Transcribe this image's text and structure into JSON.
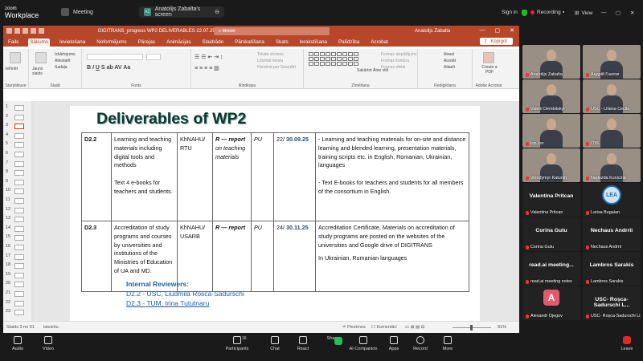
{
  "zoom": {
    "logo_top": "zoom",
    "logo_bottom": "Workplace",
    "tabs": [
      {
        "label": "Meeting"
      },
      {
        "label": "Anatolijs Zabalta's screen",
        "badge": "AZ"
      }
    ],
    "right": {
      "signin": "Sign in",
      "recording": "Recording",
      "view": "View"
    },
    "controls": [
      {
        "label": "Audio"
      },
      {
        "label": "Video"
      },
      {
        "label": "Participants",
        "count": "16"
      },
      {
        "label": "Chat"
      },
      {
        "label": "React"
      },
      {
        "label": "Share"
      },
      {
        "label": "AI Companion"
      },
      {
        "label": "Apps"
      },
      {
        "label": "Record"
      },
      {
        "label": "More"
      },
      {
        "label": "Leave"
      }
    ]
  },
  "ppt": {
    "title": "DIGITRANS_progress WP2 DELIVERABLES 22.07.25 Zabalta  -  PowerPoint",
    "search_placeholder": "Meklēt",
    "user": "Anatolijs Zabalta",
    "menu_tabs": [
      "Fails",
      "Sākums",
      "Ievietošana",
      "Noformējums",
      "Pārejas",
      "Animācijas",
      "Slaidrāde",
      "Pārskatīšana",
      "Skats",
      "Ierakstīšana",
      "Palīdzība",
      "Acrobat"
    ],
    "active_tab": "Sākums",
    "share_label": "Kopīgot",
    "ribbon": {
      "paste": "Ielīmēt",
      "new_slide": "Jauns slaids",
      "layout": "Izkārtojums",
      "reset": "Atiestatīt",
      "section": "Sadaļa",
      "groups": [
        "Starpliktuve",
        "Slaidi",
        "Fonts",
        "Rindkopa",
        "Zīmēšana",
        "Rediģēšana",
        "Adobe Acrobat"
      ],
      "text_direction": "Teksta virziens",
      "align_text": "Līdzināt tekstu",
      "smartart": "Pārvērst par SmartArt",
      "arrange": "Sakārtot",
      "quick_styles": "Ātrie stili",
      "shape_fill": "Formas aizpildījums",
      "shape_outline": "Formas kontūra",
      "shape_effects": "Formas efekti",
      "find": "Atrast",
      "replace": "Aizstāt",
      "select": "Atlasīt",
      "create_pdf": "Create a PDF"
    },
    "thumbnail_numbers": [
      "1",
      "2",
      "3",
      "4",
      "5",
      "6",
      "7",
      "8",
      "9",
      "10",
      "11",
      "12",
      "13",
      "14",
      "15",
      "16",
      "17",
      "18",
      "19",
      "20",
      "21",
      "22",
      "23"
    ],
    "slide": {
      "title": "Deliverables of WP2",
      "rows": [
        {
          "id": "D2.2",
          "name": "Learning and teaching materials including digital tools and methods",
          "name_extra": "Text 4 e-books for teachers and students.",
          "lead": "KhNAHU/ RTU",
          "type_bold": "R — report",
          "type_rest": "on teaching materials",
          "dissem": "PU",
          "month": "22/",
          "date": "30.09.25",
          "desc1": "- Learning and teaching materials for on-site and distance learning and blended learning, presentation materials, training scripts etc. in English, Romanian, Ukrainian, languages",
          "desc2": "- Text E-books for teachers and students for all members of the consortium in English."
        },
        {
          "id": "D2.3",
          "name": "Accreditation of study programs and courses by universities and institutions of the Ministries of Education of UA and MD.",
          "name_extra": "",
          "lead": "KhNAHU/ USARB",
          "type_bold": "R — report",
          "type_rest": "",
          "dissem": "PU",
          "month": "24/",
          "date": "30.11.25",
          "desc1": "Accreditation Certificate, Materials on accreditation of study programs are posted on the websites of the universities and Google drive of DIGITRANS",
          "desc2": "In Ukrainian, Rumanian languages"
        }
      ],
      "reviewers_title": "Internal Reviewers:",
      "reviewer1": "D2.2 - USC, Liudmila Rosca-Sadurschi",
      "reviewer2": "D2.3 - TUM, Irina Tututnaru"
    },
    "status": {
      "slide_info": "Slaids 3 no 51",
      "language": "latviešu",
      "notes": "Piezīmes",
      "comments": "Komentāri",
      "zoom": "91%"
    }
  },
  "gallery": [
    {
      "name": "Anatolijs Zabalta",
      "kind": "video"
    },
    {
      "name": "Андрій Гнатов",
      "kind": "video"
    },
    {
      "name": "Valerii Dembitskyi",
      "kind": "video"
    },
    {
      "name": "USC - Liliana Cecilu",
      "kind": "video"
    },
    {
      "name": "Ion Ion",
      "kind": "video"
    },
    {
      "name": "ITIS",
      "kind": "video"
    },
    {
      "name": "Volodymyr Katunin",
      "kind": "video"
    },
    {
      "name": "Nadezda Kunicina",
      "kind": "video"
    },
    {
      "name": "Valentina Pritcan",
      "big": "Valentina Pritcan",
      "kind": "name"
    },
    {
      "name": "Larisa Bugaian",
      "kind": "logo",
      "logo": "LEA"
    },
    {
      "name": "Corina Gutu",
      "big": "Corina Gutu",
      "kind": "name"
    },
    {
      "name": "Nechaus Andrrii",
      "big": "Nechaus Andrrii",
      "kind": "name"
    },
    {
      "name": "read.ai meeting notes",
      "big": "read.ai meeting...",
      "kind": "name"
    },
    {
      "name": "Lambros Sarakis",
      "big": "Lambros Sarakis",
      "kind": "name"
    },
    {
      "name": "Alexandr Ojegov",
      "kind": "avatar",
      "letter": "A"
    },
    {
      "name": "USC- Roșca-Sadurschi Li...",
      "big": "USC- Roșca-Sadurschi L...",
      "kind": "name"
    }
  ]
}
